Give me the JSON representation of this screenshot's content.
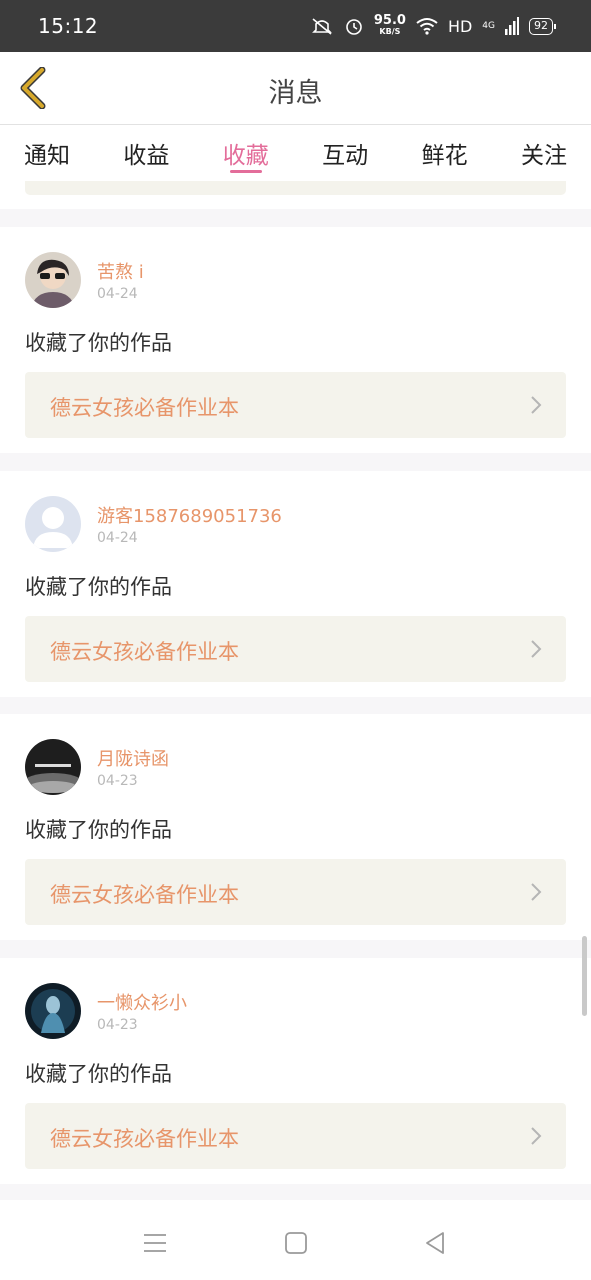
{
  "status_bar": {
    "time": "15:12",
    "speed_value": "95.0",
    "speed_unit": "KB/S",
    "hd": "HD",
    "network": "4G",
    "battery": "92"
  },
  "header": {
    "title": "消息"
  },
  "tabs": [
    {
      "label": "通知",
      "active": false
    },
    {
      "label": "收益",
      "active": false
    },
    {
      "label": "收藏",
      "active": true
    },
    {
      "label": "互动",
      "active": false
    },
    {
      "label": "鲜花",
      "active": false
    },
    {
      "label": "关注",
      "active": false
    }
  ],
  "cards": [
    {
      "username": "苦熬 i",
      "date": "04-24",
      "action": "收藏了你的作品",
      "work_title": "德云女孩必备作业本",
      "avatar": "photo-avatar"
    },
    {
      "username": "游客1587689051736",
      "date": "04-24",
      "action": "收藏了你的作品",
      "work_title": "德云女孩必备作业本",
      "avatar": "default-avatar"
    },
    {
      "username": "月陇诗函",
      "date": "04-23",
      "action": "收藏了你的作品",
      "work_title": "德云女孩必备作业本",
      "avatar": "dark-avatar"
    },
    {
      "username": "一懒众衫小",
      "date": "04-23",
      "action": "收藏了你的作品",
      "work_title": "德云女孩必备作业本",
      "avatar": "blue-avatar"
    }
  ],
  "colors": {
    "accent": "#e36d9a",
    "username": "#e7956a",
    "back_arrow": "#d7a92b"
  }
}
